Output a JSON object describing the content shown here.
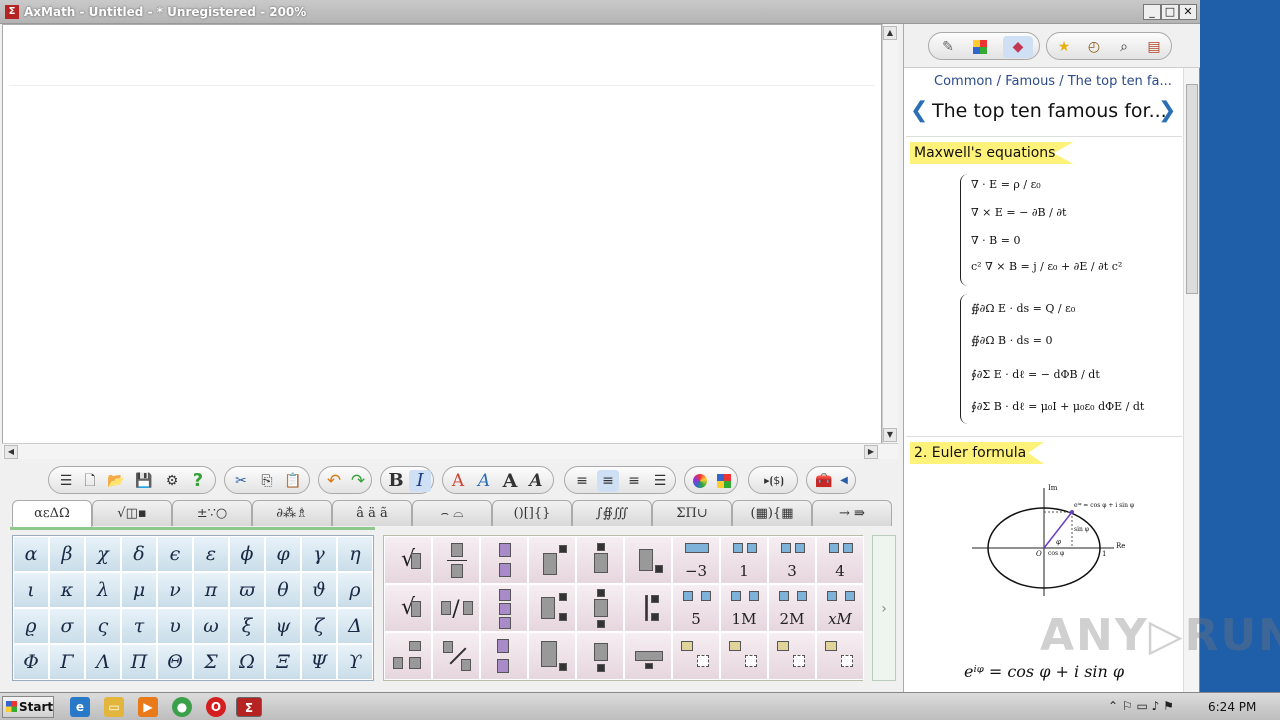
{
  "window": {
    "title": "AxMath - Untitled - * Unregistered - 200%",
    "app_icon": "Σ",
    "minimize": "_",
    "maximize": "□",
    "close": "✕"
  },
  "toolbar": {
    "bold": "B",
    "italic": "I",
    "font_color": "A",
    "font_outline": "A",
    "font_bigger": "A",
    "font_smaller": "A",
    "matrix_button": "▸⦗$⦘"
  },
  "tabs": [
    {
      "label": "αεΔΩ"
    },
    {
      "label": "√◫▪"
    },
    {
      "label": "±∵○"
    },
    {
      "label": "∂⁂♗"
    },
    {
      "label": "â ä ã"
    },
    {
      "label": "⌢ ⌓"
    },
    {
      "label": "()[]{}"
    },
    {
      "label": "∫∯∭"
    },
    {
      "label": "ΣΠ∪"
    },
    {
      "label": "(▦){▦"
    },
    {
      "label": "→ ⇛"
    }
  ],
  "greek": [
    [
      "α",
      "β",
      "χ",
      "δ",
      "ϵ",
      "ε",
      "ϕ",
      "φ",
      "γ",
      "η"
    ],
    [
      "ι",
      "κ",
      "λ",
      "μ",
      "ν",
      "π",
      "ϖ",
      "θ",
      "ϑ",
      "ρ"
    ],
    [
      "ϱ",
      "σ",
      "ς",
      "τ",
      "υ",
      "ω",
      "ξ",
      "ψ",
      "ζ",
      "Δ"
    ],
    [
      "Φ",
      "Γ",
      "Λ",
      "Π",
      "Θ",
      "Σ",
      "Ω",
      "Ξ",
      "Ψ",
      "ϒ"
    ]
  ],
  "templates": {
    "labels": [
      "−3",
      "1",
      "3",
      "4",
      "5",
      "1M",
      "2M",
      "xM"
    ],
    "sqrt": "√",
    "slash": "/"
  },
  "right_panel": {
    "breadcrumb": "Common / Famous / The top ten fa...",
    "heading": "The top ten famous for...",
    "prev": "❮",
    "next": "❯",
    "section1": "Maxwell's equations",
    "section2": "2. Euler formula",
    "maxwell_diff": [
      "∇ · E = ρ / ε₀",
      "∇ × E = − ∂B / ∂t",
      "∇ · B = 0",
      "c² ∇ × B = j / ε₀ + ∂E / ∂t c²"
    ],
    "maxwell_int": [
      "∯∂Ω E · ds = Q / ε₀",
      "∯∂Ω B · ds = 0",
      "∮∂Σ E · dℓ = − dΦB / dt",
      "∮∂Σ B · dℓ = μ₀I + μ₀ε₀ dΦE / dt"
    ],
    "euler_diagram": {
      "im_label": "Im",
      "re_label": "Re",
      "point_label": "eⁱᵠ = cos φ + i sin φ",
      "sin_label": "sin φ",
      "cos_label": "cos φ",
      "origin": "O",
      "one": "1",
      "phi": "φ"
    },
    "euler_formula": "eⁱᵠ = cos φ + i sin φ"
  },
  "taskbar": {
    "start": "Start",
    "clock": "6:24 PM"
  },
  "watermark": "ANY▷RUN"
}
